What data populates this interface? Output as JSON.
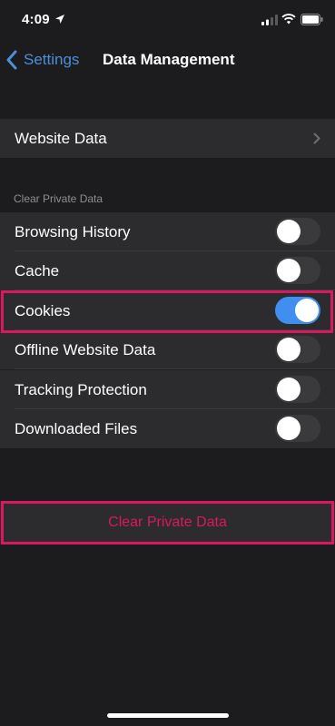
{
  "status_bar": {
    "time": "4:09",
    "icons": [
      "location-arrow-icon",
      "cellular-signal-icon",
      "wifi-icon",
      "battery-icon"
    ]
  },
  "nav": {
    "back_label": "Settings",
    "title": "Data Management"
  },
  "website_data": {
    "label": "Website Data"
  },
  "clear_section": {
    "header": "Clear Private Data",
    "items": [
      {
        "label": "Browsing History",
        "on": false
      },
      {
        "label": "Cache",
        "on": false
      },
      {
        "label": "Cookies",
        "on": true
      },
      {
        "label": "Offline Website Data",
        "on": false
      },
      {
        "label": "Tracking Protection",
        "on": false
      },
      {
        "label": "Downloaded Files",
        "on": false
      }
    ]
  },
  "clear_button": {
    "label": "Clear Private Data"
  },
  "colors": {
    "accent_blue": "#4a90d9",
    "toggle_on": "#3f8ef0",
    "highlight": "#d9185f",
    "background": "#1c1c1e",
    "cell": "#2c2c2e"
  }
}
